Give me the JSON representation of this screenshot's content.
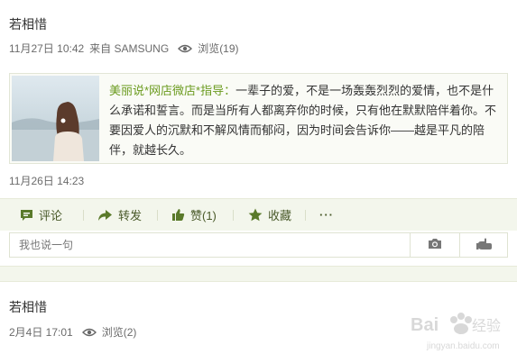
{
  "post1": {
    "author": "若相惜",
    "date": "11月27日 10:42",
    "source": "来自 SAMSUNG",
    "views": "浏览(19)",
    "shared": {
      "source_label": "美丽说*网店微店*指导：",
      "text": "一辈子的爱，不是一场轰轰烈烈的爱情，也不是什么承诺和誓言。而是当所有人都离弃你的时候，只有他在默默陪伴着你。不要因爱人的沉默和不解风情而郁闷，因为时间会告诉你——越是平凡的陪伴，就越长久。",
      "date": "11月26日 14:23"
    },
    "actions": {
      "comment": "评论",
      "repost": "转发",
      "like": "赞(1)",
      "favorite": "收藏",
      "more": "···"
    },
    "comment_placeholder": "我也说一句"
  },
  "post2": {
    "author": "若相惜",
    "date": "2月4日 17:01",
    "views": "浏览(2)"
  },
  "colors": {
    "accent_green": "#6b9b1f",
    "action_bg": "#f3f6ec",
    "icon_green": "#5a7a2a"
  },
  "watermark": "Baidu 经验 jingyan.baidu.com"
}
